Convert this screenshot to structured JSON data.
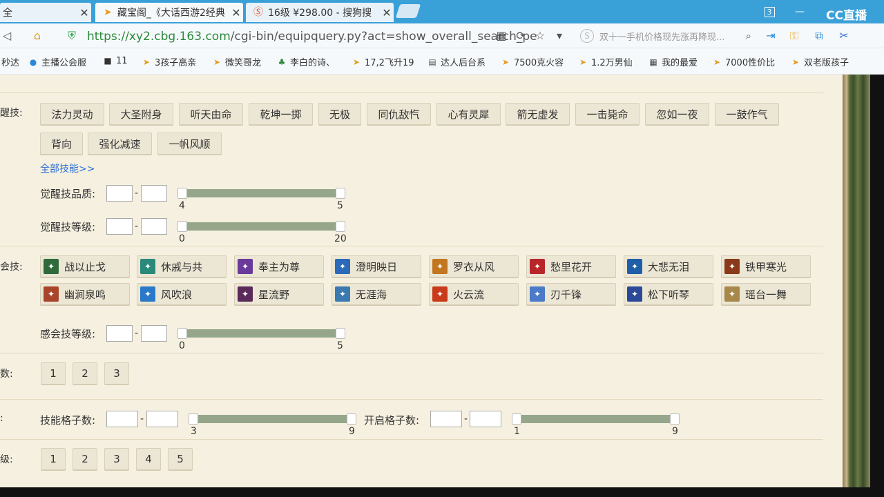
{
  "tabs": [
    {
      "label": "全",
      "active": false
    },
    {
      "label": "藏宝阁_《大话西游2经典",
      "active": true
    },
    {
      "label": "16级 ¥298.00 - 搜狗搜",
      "active": false
    }
  ],
  "window": {
    "tab_count": "3",
    "brand": "CC直播"
  },
  "address": {
    "url_host": "https://xy2.cbg.163.com",
    "url_path": "/cgi-bin/equipquery.py?act=show_overall_search_pe",
    "search_placeholder": "双十一手机价格现先涨再降现..."
  },
  "bookmarks": [
    "秒达",
    "主播公会服",
    "11",
    "3孩子高亲",
    "微笑哥龙",
    "李白的诗、",
    "17,2飞升19",
    "达人后台系",
    "7500克火容",
    "1.2万男仙",
    "我的最爱",
    "7000性价比",
    "双老版孩子"
  ],
  "awaken": {
    "label": "醒技:",
    "skills": [
      "法力灵动",
      "大圣附身",
      "听天由命",
      "乾坤一掷",
      "无极",
      "同仇敌忾",
      "心有灵犀",
      "箭无虚发",
      "一击毙命",
      "忽如一夜",
      "一鼓作气",
      "背向",
      "强化减速",
      "一帆风顺"
    ],
    "all_link": "全部技能>>",
    "quality_label": "觉醒技品质:",
    "quality_min": "4",
    "quality_max": "5",
    "level_label": "觉醒技等级:",
    "level_min": "0",
    "level_max": "20"
  },
  "sense": {
    "label": "会技:",
    "skills": [
      {
        "name": "战以止戈",
        "color": "#2f6b3a"
      },
      {
        "name": "休戚与共",
        "color": "#2a8a7a"
      },
      {
        "name": "奉主为尊",
        "color": "#6a3a9a"
      },
      {
        "name": "澄明映日",
        "color": "#2a6ab8"
      },
      {
        "name": "罗衣从风",
        "color": "#c2761f"
      },
      {
        "name": "愁里花开",
        "color": "#b8262a"
      },
      {
        "name": "大悲无泪",
        "color": "#1f5fa8"
      },
      {
        "name": "铁甲寒光",
        "color": "#8a3a1a"
      },
      {
        "name": "幽涧泉鸣",
        "color": "#a8442a"
      },
      {
        "name": "风吹浪",
        "color": "#2a78c8"
      },
      {
        "name": "星流野",
        "color": "#5a2a5a"
      },
      {
        "name": "无涯海",
        "color": "#3a7ab0"
      },
      {
        "name": "火云流",
        "color": "#c83a1a"
      },
      {
        "name": "刃千锋",
        "color": "#4a7ac8"
      },
      {
        "name": "松下听琴",
        "color": "#2a4a98"
      },
      {
        "name": "瑶台一舞",
        "color": "#a8884a"
      }
    ],
    "level_label": "感会技等级:",
    "level_min": "0",
    "level_max": "5"
  },
  "count_row": {
    "label": "数:",
    "options": [
      "1",
      "2",
      "3"
    ]
  },
  "grid_row": {
    "label": ":",
    "skill_grid_label": "技能格子数:",
    "skill_grid_min": "3",
    "skill_grid_max": "9",
    "open_grid_label": "开启格子数:",
    "open_grid_min": "1",
    "open_grid_max": "9"
  },
  "level_row": {
    "label": "级:",
    "options": [
      "1",
      "2",
      "3",
      "4",
      "5"
    ]
  }
}
